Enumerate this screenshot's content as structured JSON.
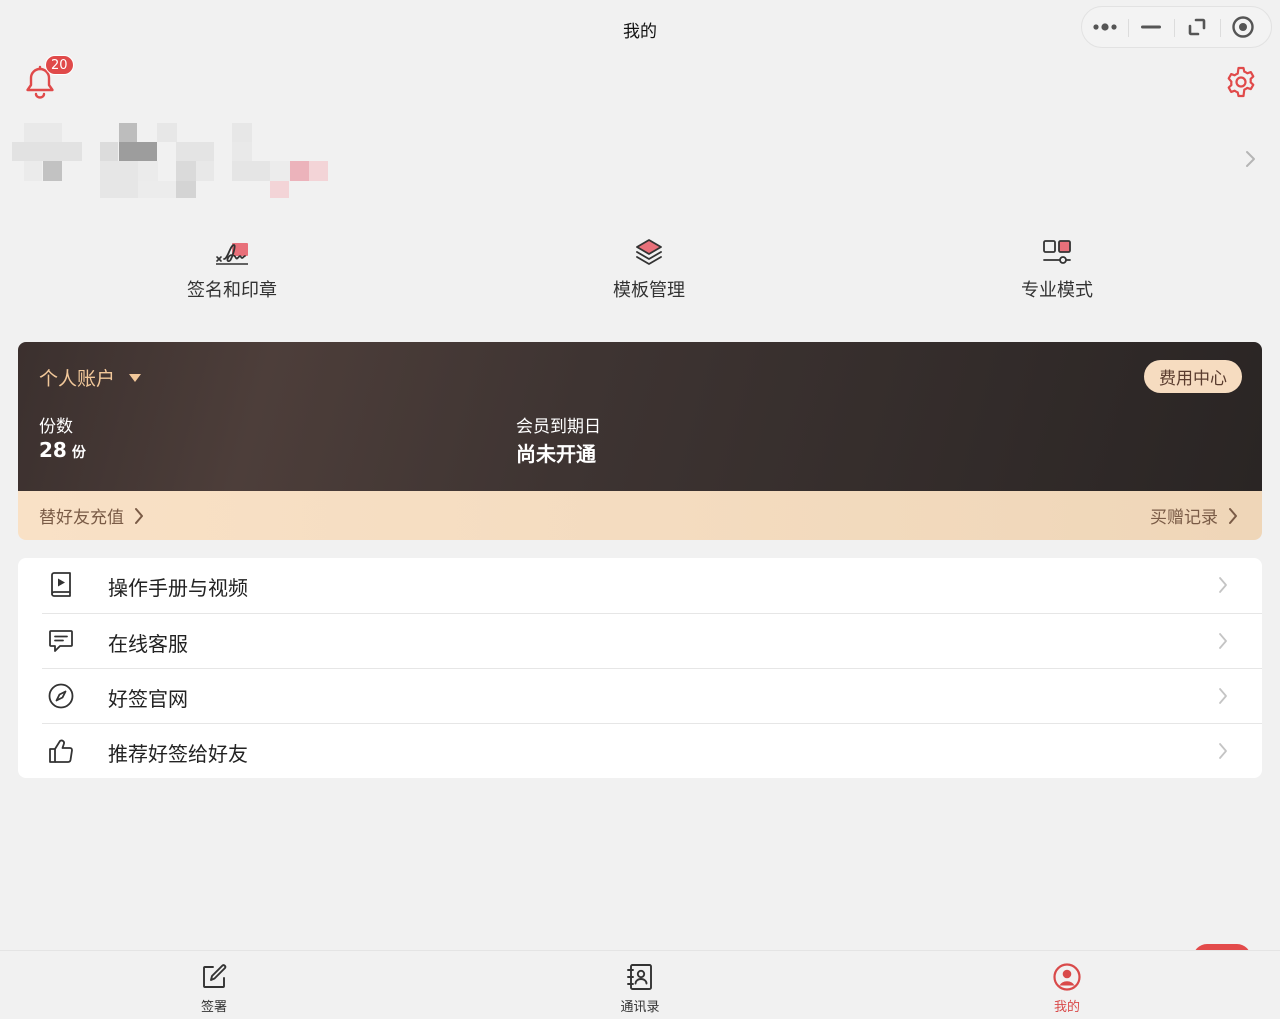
{
  "window": {
    "title": "我的",
    "capsule_buttons": [
      "more-icon",
      "minimize-icon",
      "restore-icon",
      "record-icon"
    ]
  },
  "header": {
    "notification_count": "20",
    "accent_color": "#e04a4a"
  },
  "quick_actions": [
    {
      "label": "签名和印章",
      "icon": "signature-icon"
    },
    {
      "label": "模板管理",
      "icon": "layers-icon"
    },
    {
      "label": "专业模式",
      "icon": "pro-mode-icon"
    }
  ],
  "account": {
    "type_label": "个人账户",
    "fee_center_label": "费用中心",
    "copies_label": "份数",
    "copies_value": "28",
    "copies_unit": "份",
    "member_expiry_label": "会员到期日",
    "member_expiry_value": "尚未开通",
    "recharge_for_friend_label": "替好友充值",
    "purchase_records_label": "买赠记录",
    "card_color": "#3b302e",
    "gold_color": "#f2c89a"
  },
  "menu": [
    {
      "label": "操作手册与视频",
      "icon": "manual-video-icon"
    },
    {
      "label": "在线客服",
      "icon": "chat-icon"
    },
    {
      "label": "好签官网",
      "icon": "compass-icon"
    },
    {
      "label": "推荐好签给好友",
      "icon": "thumbs-up-icon"
    }
  ],
  "tabs": [
    {
      "label": "签署",
      "icon": "edit-icon",
      "active": false
    },
    {
      "label": "通讯录",
      "icon": "contacts-icon",
      "active": false
    },
    {
      "label": "我的",
      "icon": "user-icon",
      "active": true
    }
  ]
}
